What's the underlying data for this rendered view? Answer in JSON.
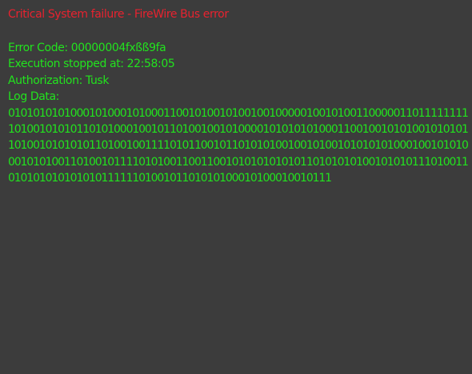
{
  "window": {
    "title": "Critical System failure - FireWire Bus error"
  },
  "details": {
    "error_code": "Error Code: 00000004fxßß9fa",
    "execution_stopped": "Execution stopped at: 22:58:05",
    "authorization": "Authorization: Tusk",
    "log_label": "Log Data:"
  },
  "log_lines": [
    "01010101010001010001010001100101001010010010000010010100110000011011111111",
    "10100101010110101000100101101001001010000101010101000110010010101001010101",
    "10100101010101101001001111010110010110101010010010100101010101000100101010101",
    "001010100110100101111010100110011001010101010101101010101001010101110100111",
    "0101010101010101111110100101101010100010100010010111"
  ],
  "colors": {
    "background": "#3c3c3c",
    "error_text": "#e8222f",
    "console_text": "#22e31e"
  }
}
